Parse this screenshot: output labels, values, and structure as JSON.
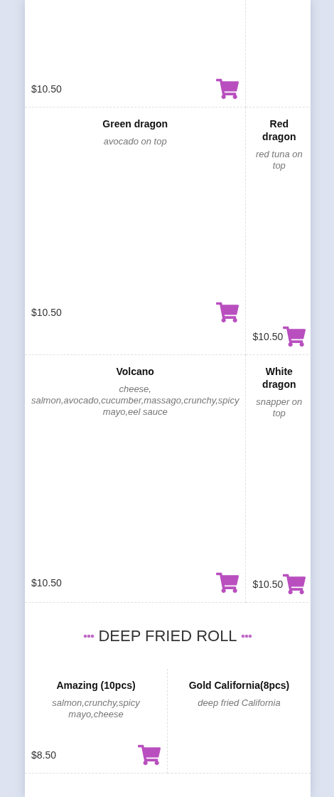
{
  "sections": [
    {
      "items": [
        {
          "kind": "dish",
          "price": "$10.50"
        },
        {
          "kind": "blank"
        },
        {
          "kind": "dish",
          "name": "Green dragon",
          "description": "avocado on top",
          "price": "$10.50"
        },
        {
          "kind": "dish",
          "name": "Red dragon",
          "description": "red tuna on top",
          "price": "$10.50"
        },
        {
          "kind": "dish",
          "name": "Volcano",
          "description": "cheese, salmon,avocado,cucumber,massago,crunchy,spicy mayo,eel sauce",
          "price": "$10.50"
        },
        {
          "kind": "dish",
          "name": "White dragon",
          "description": "snapper on top",
          "price": "$10.50"
        }
      ]
    },
    {
      "title": "DEEP FRIED ROLL",
      "items": [
        {
          "kind": "dish",
          "name": "Amazing (10pcs)",
          "description": "salmon,crunchy,spicy mayo,cheese",
          "price": "$8.50"
        },
        {
          "kind": "dish",
          "name": "Gold California(8pcs)",
          "description": "deep fried California"
        }
      ]
    }
  ]
}
